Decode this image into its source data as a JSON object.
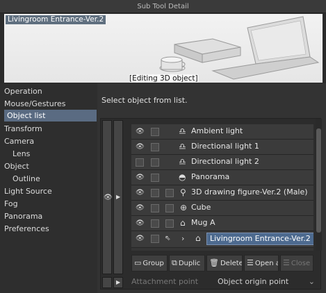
{
  "window_title": "Sub Tool Detail",
  "preview": {
    "name": "Livingroom Entrance-Ver.2",
    "editing_label": "[Editing 3D object]"
  },
  "sidebar": {
    "items": [
      {
        "label": "Operation",
        "selected": false
      },
      {
        "label": "Mouse/Gestures",
        "selected": false
      },
      {
        "label": "Object list",
        "selected": true
      },
      {
        "label": "Transform",
        "selected": false
      },
      {
        "label": "Camera",
        "selected": false
      },
      {
        "label": "Lens",
        "selected": false
      },
      {
        "label": "Object",
        "selected": false
      },
      {
        "label": "Outline",
        "selected": false
      },
      {
        "label": "Light Source",
        "selected": false
      },
      {
        "label": "Fog",
        "selected": false
      },
      {
        "label": "Panorama",
        "selected": false
      },
      {
        "label": "Preferences",
        "selected": false
      }
    ]
  },
  "main": {
    "instruction": "Select object from list.",
    "objects": [
      {
        "label": "Ambient light",
        "icon": "light-icon"
      },
      {
        "label": "Directional light 1",
        "icon": "light-icon"
      },
      {
        "label": "Directional light 2",
        "icon": "light-icon"
      },
      {
        "label": "Panorama",
        "icon": "panorama-icon"
      },
      {
        "label": "3D drawing figure-Ver.2 (Male)",
        "icon": "figure-icon"
      },
      {
        "label": "Cube",
        "icon": "globe-icon"
      },
      {
        "label": "Mug A",
        "icon": "lock-icon"
      },
      {
        "label": "Livingroom Entrance-Ver.2",
        "icon": "lock-icon",
        "selected": true
      }
    ],
    "toolbar": {
      "group": "Group",
      "duplicate": "Duplic",
      "delete": "Delete",
      "open": "Open a",
      "close": "Close a"
    },
    "attachment": {
      "label": "Attachment point",
      "value": "Object origin point"
    }
  }
}
